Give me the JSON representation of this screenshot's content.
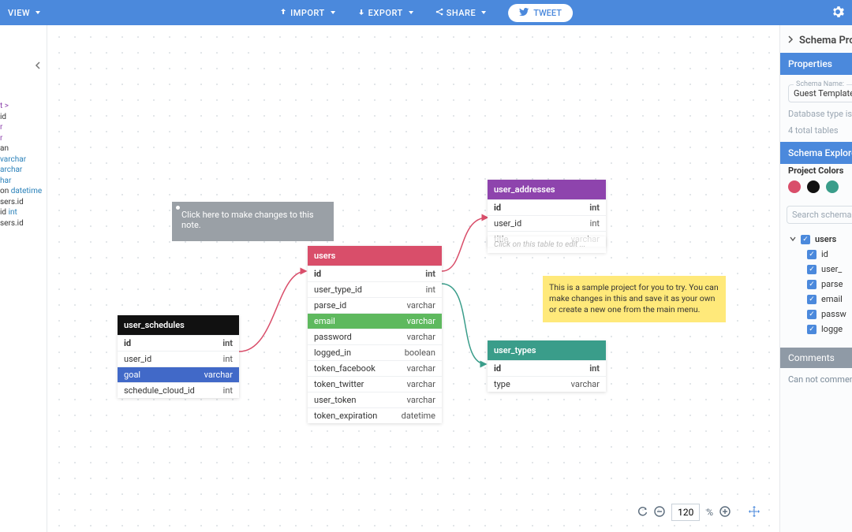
{
  "toolbar": {
    "view": "VIEW",
    "import": "IMPORT",
    "export": "EXPORT",
    "share": "SHARE",
    "tweet": "TWEET"
  },
  "code_lines": [
    {
      "t": "t >",
      "cls": "kw"
    },
    {
      "t": "id",
      "cls": ""
    },
    {
      "t": "r",
      "cls": "kw"
    },
    {
      "t": "",
      "cls": ""
    },
    {
      "t": "r",
      "cls": "kw"
    },
    {
      "t": "an",
      "cls": ""
    },
    {
      "t": "varchar",
      "cls": "ty"
    },
    {
      "t": "archar",
      "cls": "ty"
    },
    {
      "t": "har",
      "cls": "ty"
    },
    {
      "t": "on ",
      "cls": "",
      "tail": "datetime",
      "tailcls": "ty"
    },
    {
      "t": "",
      "cls": ""
    },
    {
      "t": "",
      "cls": ""
    },
    {
      "t": "",
      "cls": ""
    },
    {
      "t": "sers.id",
      "cls": ""
    },
    {
      "t": "",
      "cls": ""
    },
    {
      "t": "id ",
      "cls": "",
      "tail": "int",
      "tailcls": "ty"
    },
    {
      "t": "",
      "cls": ""
    },
    {
      "t": "",
      "cls": ""
    },
    {
      "t": "",
      "cls": ""
    },
    {
      "t": "",
      "cls": ""
    },
    {
      "t": "",
      "cls": ""
    },
    {
      "t": "sers.id",
      "cls": ""
    }
  ],
  "notes": {
    "grey": "Click here to make changes to this note.",
    "yellow": "This is a sample project for you to try. You can make changes in this and save it as your own or create a new one from the main menu."
  },
  "ghost_hint": "Click on this table to edit ...",
  "tables": {
    "users": {
      "name": "users",
      "rows": [
        {
          "l": "id",
          "r": "int",
          "bold": true
        },
        {
          "l": "user_type_id",
          "r": "int"
        },
        {
          "l": "parse_id",
          "r": "varchar"
        },
        {
          "l": "email",
          "r": "varchar",
          "hl": "email"
        },
        {
          "l": "password",
          "r": "varchar"
        },
        {
          "l": "logged_in",
          "r": "boolean"
        },
        {
          "l": "token_facebook",
          "r": "varchar"
        },
        {
          "l": "token_twitter",
          "r": "varchar"
        },
        {
          "l": "user_token",
          "r": "varchar"
        },
        {
          "l": "token_expiration",
          "r": "datetime"
        }
      ]
    },
    "user_addresses": {
      "name": "user_addresses",
      "rows": [
        {
          "l": "id",
          "r": "int",
          "bold": true
        },
        {
          "l": "user_id",
          "r": "int"
        },
        {
          "l": "title",
          "r": "varchar"
        }
      ]
    },
    "user_types": {
      "name": "user_types",
      "rows": [
        {
          "l": "id",
          "r": "int",
          "bold": true
        },
        {
          "l": "type",
          "r": "varchar"
        }
      ]
    },
    "user_schedules": {
      "name": "user_schedules",
      "rows": [
        {
          "l": "id",
          "r": "int",
          "bold": true
        },
        {
          "l": "user_id",
          "r": "int"
        },
        {
          "l": "goal",
          "r": "varchar",
          "hl": "goal"
        },
        {
          "l": "schedule_cloud_id",
          "r": "int"
        }
      ]
    }
  },
  "zoom": {
    "value": "120",
    "unit": "%"
  },
  "panel": {
    "title": "Schema Prop",
    "tab_props": "Properties",
    "schema_name_label": "Schema Name:",
    "schema_name_value": "Guest Template",
    "db_type": "Database type is",
    "total_tables": "4 total tables",
    "tab_explorer": "Schema Explorer",
    "colors_label": "Project Colors",
    "colors": [
      "#d94e6a",
      "#111111",
      "#3a9d8a"
    ],
    "search_placeholder": "Search schema",
    "tree": {
      "root": "users",
      "fields": [
        "id",
        "user_",
        "parse",
        "email",
        "passw",
        "logge"
      ]
    },
    "comments_tab": "Comments",
    "comments_msg": "Can not commen"
  }
}
